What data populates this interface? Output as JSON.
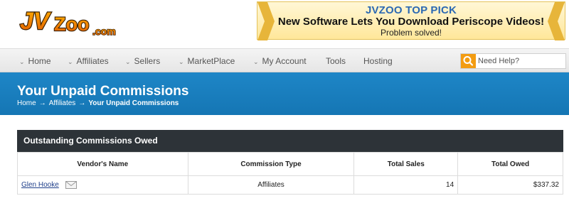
{
  "logo": {
    "alt": "JVZoo.com"
  },
  "promo": {
    "title": "JVZOO TOP PICK",
    "headline": "New Software Lets You Download Periscope Videos!",
    "subtext": "Problem solved!"
  },
  "nav": {
    "items": [
      {
        "label": "Home",
        "caret": true
      },
      {
        "label": "Affiliates",
        "caret": true
      },
      {
        "label": "Sellers",
        "caret": true
      },
      {
        "label": "MarketPlace",
        "caret": true
      },
      {
        "label": "My Account",
        "caret": true
      },
      {
        "label": "Tools",
        "caret": false
      },
      {
        "label": "Hosting",
        "caret": false
      }
    ],
    "caret_glyph": "⌄",
    "search_placeholder": "Need Help?"
  },
  "banner": {
    "title": "Your Unpaid Commissions",
    "breadcrumb": [
      "Home",
      "Affiliates",
      "Your Unpaid Commissions"
    ],
    "separator": "→"
  },
  "table": {
    "heading": "Outstanding Commissions Owed",
    "columns": [
      "Vendor's Name",
      "Commission Type",
      "Total Sales",
      "Total Owed"
    ],
    "rows": [
      {
        "vendor": "Glen Hooke",
        "type": "Affiliates",
        "sales": "14",
        "owed": "$337.32"
      }
    ]
  },
  "colors": {
    "banner_blue": "#1a80c0",
    "promo_title_blue": "#2b69b3",
    "search_orange": "#f39c12",
    "table_head_dark": "#2d3338"
  }
}
